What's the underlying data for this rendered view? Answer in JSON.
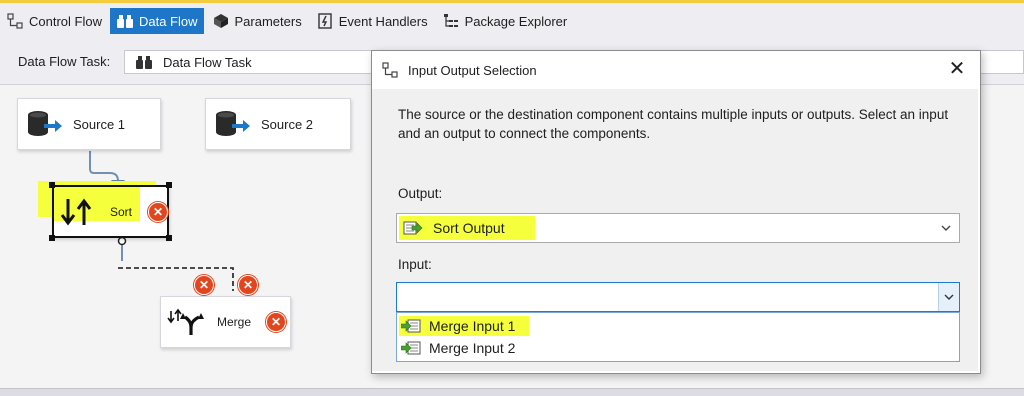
{
  "tabs": [
    {
      "label": "Control Flow",
      "icon": "control-flow-icon",
      "active": false
    },
    {
      "label": "Data Flow",
      "icon": "data-flow-icon",
      "active": true
    },
    {
      "label": "Parameters",
      "icon": "parameters-icon",
      "active": false
    },
    {
      "label": "Event Handlers",
      "icon": "event-handlers-icon",
      "active": false
    },
    {
      "label": "Package Explorer",
      "icon": "package-explorer-icon",
      "active": false
    }
  ],
  "task": {
    "label": "Data Flow Task:",
    "value": "Data Flow Task"
  },
  "canvas": {
    "nodes": {
      "source1": {
        "label": "Source 1",
        "icon": "source-icon"
      },
      "source2": {
        "label": "Source 2",
        "icon": "source-icon"
      },
      "sort": {
        "label": "Sort",
        "icon": "sort-icon",
        "selected": true,
        "highlighted": true
      },
      "merge": {
        "label": "Merge",
        "icon": "merge-icon"
      }
    },
    "error_badges": 4
  },
  "dialog": {
    "title": "Input Output Selection",
    "close": "✕",
    "description": "The source or the destination component contains multiple inputs or outputs. Select an input and an output to connect the components.",
    "output_label": "Output:",
    "output_value": "Sort Output",
    "input_label": "Input:",
    "input_value": "",
    "input_options": [
      "Merge Input 1",
      "Merge Input 2"
    ]
  },
  "colors": {
    "active_tab": "#1d76c7",
    "highlight": "#f6ff3c",
    "error": "#e2461e",
    "focus_border": "#1b7ad6"
  }
}
